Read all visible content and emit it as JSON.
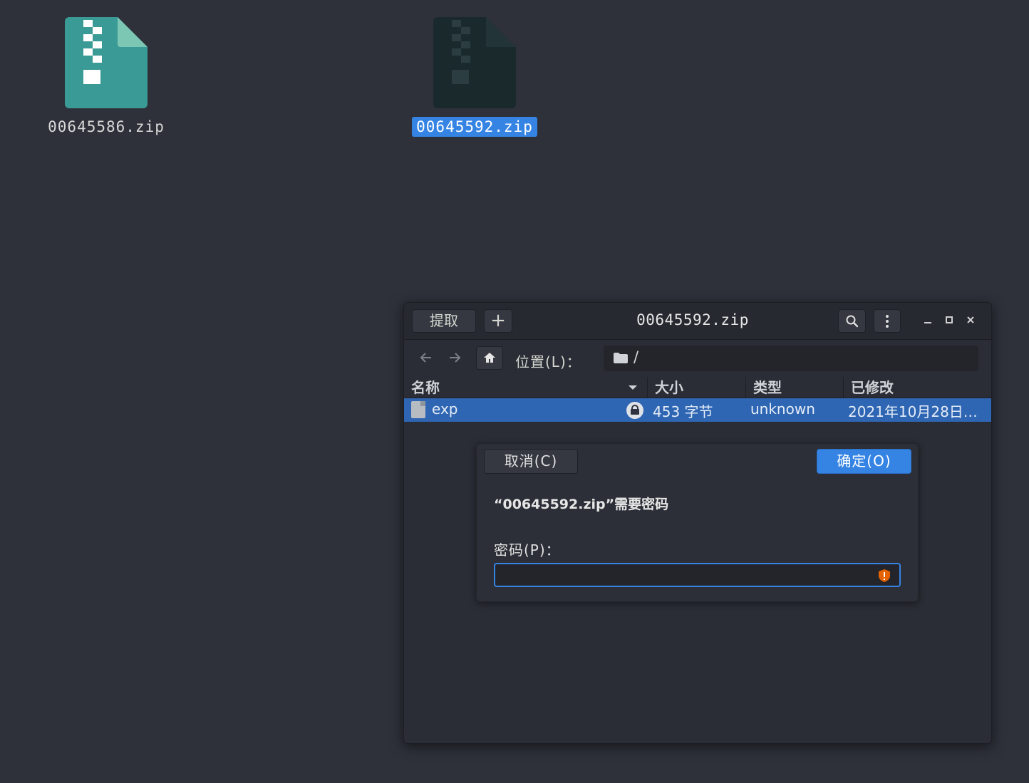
{
  "desktop": {
    "icons": [
      {
        "label": "00645586.zip",
        "selected": false
      },
      {
        "label": "00645592.zip",
        "selected": true
      }
    ]
  },
  "window": {
    "title": "00645592.zip",
    "extract_label": "提取",
    "add_label": "+",
    "location_label": "位置(L)：",
    "location_path": "/",
    "columns": [
      "名称",
      "大小",
      "类型",
      "已修改"
    ],
    "rows": [
      {
        "name": "exp",
        "size": "453 字节",
        "type": "unknown",
        "modified": "2021年10月28日…",
        "encrypted": true
      }
    ]
  },
  "dialog": {
    "cancel_label": "取消(C)",
    "ok_label": "确定(O)",
    "message": "“00645592.zip”需要密码",
    "password_label": "密码(P)：",
    "password_value": ""
  },
  "colors": {
    "accent": "#3584e4",
    "zip_teal": "#3a9a95",
    "selection_row": "#2f66b3",
    "warning": "#e66100"
  }
}
